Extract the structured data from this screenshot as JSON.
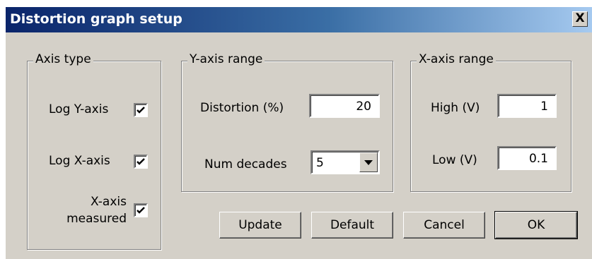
{
  "window": {
    "title": "Distortion graph setup",
    "close_label": "X"
  },
  "axis_type": {
    "legend": "Axis type",
    "log_y": {
      "label": "Log Y-axis",
      "checked": true
    },
    "log_x": {
      "label": "Log X-axis",
      "checked": true
    },
    "x_measured": {
      "label_line1": "X-axis",
      "label_line2": "measured",
      "checked": true
    }
  },
  "y_range": {
    "legend": "Y-axis range",
    "distortion_label": "Distortion (%)",
    "distortion_value": "20",
    "decades_label": "Num decades",
    "decades_value": "5"
  },
  "x_range": {
    "legend": "X-axis range",
    "high_label": "High (V)",
    "high_value": "1",
    "low_label": "Low (V)",
    "low_value": "0.1"
  },
  "buttons": {
    "update": "Update",
    "default": "Default",
    "cancel": "Cancel",
    "ok": "OK"
  }
}
